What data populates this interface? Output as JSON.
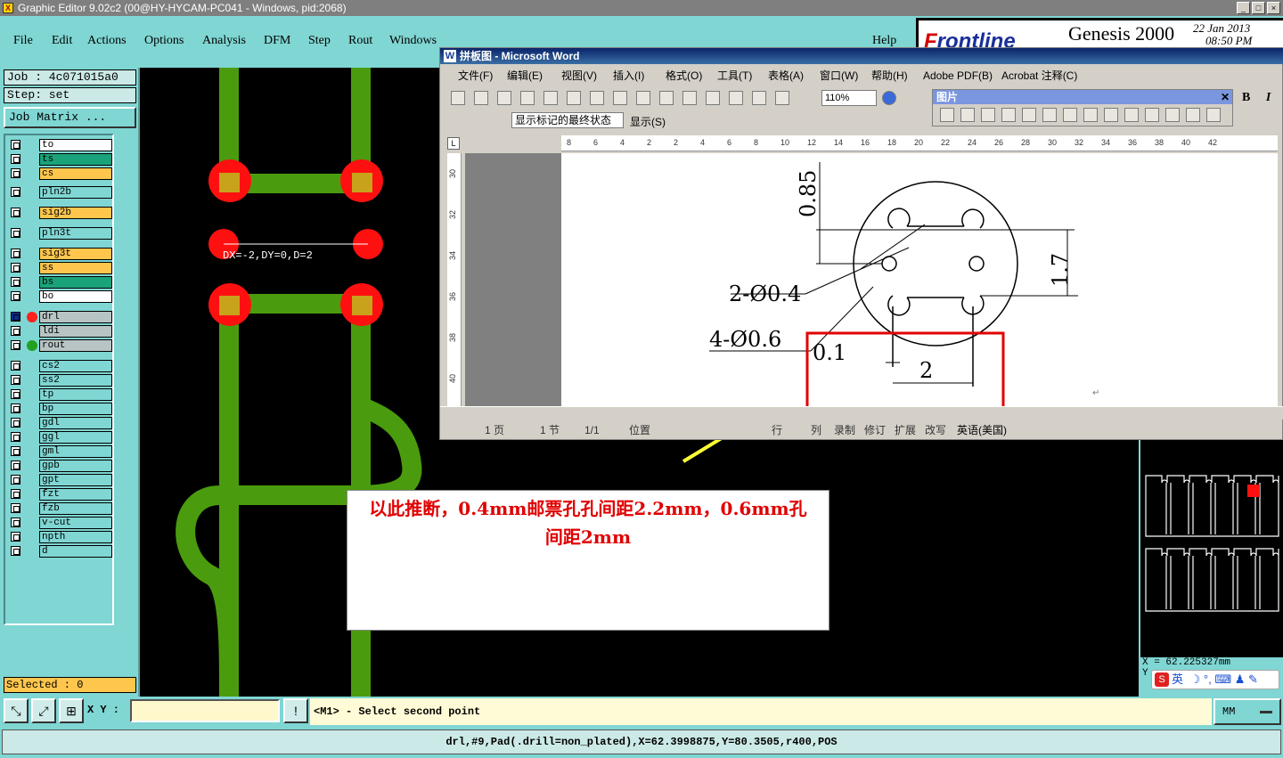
{
  "window": {
    "title": "Graphic Editor 9.02c2 (00@HY-HYCAM-PC041 - Windows, pid:2068)"
  },
  "menu": {
    "items": [
      "File",
      "Edit",
      "Actions",
      "Options",
      "Analysis",
      "DFM",
      "Step",
      "Rout",
      "Windows"
    ],
    "help": "Help"
  },
  "brand": {
    "logo_prefix": "F",
    "logo_rest": "rontline",
    "product": "Genesis 2000",
    "date": "22 Jan 2013",
    "time": "08:50 PM"
  },
  "job": {
    "job_line": "Job : 4c071015a0",
    "step_line": "Step: set",
    "matrix_button": "Job Matrix ..."
  },
  "layers": [
    {
      "name": "to",
      "color": "#ffffff"
    },
    {
      "name": "ts",
      "color": "#1aa37a"
    },
    {
      "name": "cs",
      "color": "#ffc64d"
    },
    {
      "name": "pln2b",
      "color": "#7fd6d3"
    },
    {
      "name": "sig2b",
      "color": "#ffc64d"
    },
    {
      "name": "pln3t",
      "color": "#7fd6d3"
    },
    {
      "name": "sig3t",
      "color": "#ffc64d"
    },
    {
      "name": "ss",
      "color": "#ffc64d"
    },
    {
      "name": "bs",
      "color": "#1aa37a"
    },
    {
      "name": "bo",
      "color": "#ffffff"
    },
    {
      "name": "drl",
      "color": "#b8c4c4",
      "dot": "#ff2020",
      "active": true
    },
    {
      "name": "ldi",
      "color": "#b8c4c4"
    },
    {
      "name": "rout",
      "color": "#b8c4c4",
      "dot": "#22a022"
    },
    {
      "name": "cs2",
      "color": "#7fd6d3"
    },
    {
      "name": "ss2",
      "color": "#7fd6d3"
    },
    {
      "name": "tp",
      "color": "#7fd6d3"
    },
    {
      "name": "bp",
      "color": "#7fd6d3"
    },
    {
      "name": "gdl",
      "color": "#7fd6d3"
    },
    {
      "name": "ggl",
      "color": "#7fd6d3"
    },
    {
      "name": "gml",
      "color": "#7fd6d3"
    },
    {
      "name": "gpb",
      "color": "#7fd6d3"
    },
    {
      "name": "gpt",
      "color": "#7fd6d3"
    },
    {
      "name": "fzt",
      "color": "#7fd6d3"
    },
    {
      "name": "fzb",
      "color": "#7fd6d3"
    },
    {
      "name": "v-cut",
      "color": "#7fd6d3"
    },
    {
      "name": "npth",
      "color": "#7fd6d3"
    },
    {
      "name": "d",
      "color": "#7fd6d3"
    }
  ],
  "status": {
    "selected": "Selected : 0"
  },
  "canvas": {
    "measure_text": "DX=-2,DY=0,D=2"
  },
  "word": {
    "title": "拼板图 - Microsoft Word",
    "menu": [
      "文件(F)",
      "编辑(E)",
      "视图(V)",
      "插入(I)",
      "格式(O)",
      "工具(T)",
      "表格(A)",
      "窗口(W)",
      "帮助(H)",
      "Adobe PDF(B)",
      "Acrobat 注释(C)"
    ],
    "zoom": "110%",
    "markup_display": "显示标记的最终状态",
    "show_label": "显示(S)",
    "picture_toolbar_title": "图片",
    "format_buttons": [
      "B",
      "I"
    ],
    "ruler_ticks": [
      "8",
      "6",
      "4",
      "2",
      "2",
      "4",
      "6",
      "8",
      "10",
      "12",
      "14",
      "16",
      "18",
      "20",
      "22",
      "24",
      "26",
      "28",
      "30",
      "32",
      "34",
      "36",
      "38",
      "40",
      "42"
    ],
    "vruler_ticks": [
      "30",
      "32",
      "34",
      "36",
      "38",
      "40"
    ],
    "drawing": {
      "label_085": "0.85",
      "label_17": "1.7",
      "label_04": "2-Ø0.4",
      "label_06": "4-Ø0.6",
      "label_01": "0.1",
      "label_2": "2"
    },
    "statusbar": {
      "page": "1 页",
      "section": "1 节",
      "pages": "1/1",
      "position": "位置",
      "line": "行",
      "col": "列",
      "rec": "录制",
      "trk": "修订",
      "ext": "扩展",
      "ovr": "改写",
      "lang": "英语(美国)"
    }
  },
  "annotation": {
    "line1": "以此推断，0.4mm邮票孔孔间距2.2mm，0.6mm孔",
    "line2": "间距2mm"
  },
  "thumb": {
    "x_line": "X = 62.225327mm",
    "y_line": "Y"
  },
  "ime": {
    "lang": "英"
  },
  "command": {
    "xy_label": "X Y :",
    "xy_value": "",
    "prompt": "<M1> - Select second point",
    "units": "MM"
  },
  "info": {
    "text": "drl,#9,Pad(.drill=non_plated),X=62.3998875,Y=80.3505,r400,POS"
  },
  "colors": {
    "panel": "#7fd6d3",
    "trace": "#4a9c0e",
    "pad_red": "#ff1010",
    "pad_overlap": "#c8a21a",
    "annotation_red": "#e00000",
    "arrow_yellow": "#ffff33"
  }
}
